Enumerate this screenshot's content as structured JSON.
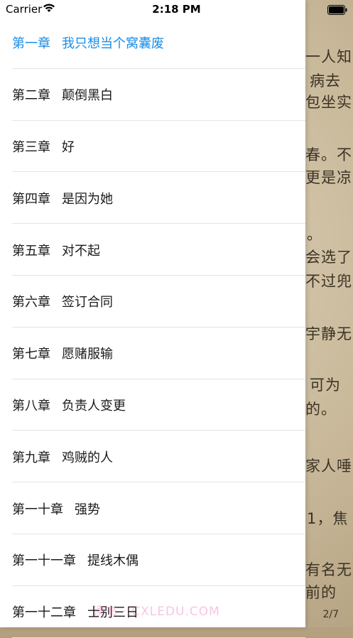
{
  "status_bar": {
    "carrier": "Carrier",
    "time": "2:18 PM"
  },
  "chapters": [
    {
      "num": "第一章",
      "title": "我只想当个窝囊废",
      "active": true
    },
    {
      "num": "第二章",
      "title": "颠倒黑白"
    },
    {
      "num": "第三章",
      "title": "好"
    },
    {
      "num": "第四章",
      "title": "是因为她"
    },
    {
      "num": "第五章",
      "title": "对不起"
    },
    {
      "num": "第六章",
      "title": "签订合同"
    },
    {
      "num": "第七章",
      "title": "愿赌服输"
    },
    {
      "num": "第八章",
      "title": "负责人变更"
    },
    {
      "num": "第九章",
      "title": "鸡贼的人"
    },
    {
      "num": "第一十章",
      "title": "强势"
    },
    {
      "num": "第一十一章",
      "title": "提线木偶"
    },
    {
      "num": "第一十二章",
      "title": "士别三日"
    }
  ],
  "reader": {
    "lines": [
      "一人知",
      "病去",
      "包坐实",
      "春。不",
      "更是凉",
      "。",
      "会选了",
      "不过兜",
      "宇静无",
      "可为",
      "的。",
      "家人唾",
      "1，焦",
      "有名无",
      "前的"
    ],
    "page_indicator": "2/7"
  },
  "watermark": "读书 · CXLEDU.COM",
  "colors": {
    "active_chapter": "#1a8ce6",
    "drawer_bg": "#ffffff",
    "paper": "#c8b899"
  }
}
